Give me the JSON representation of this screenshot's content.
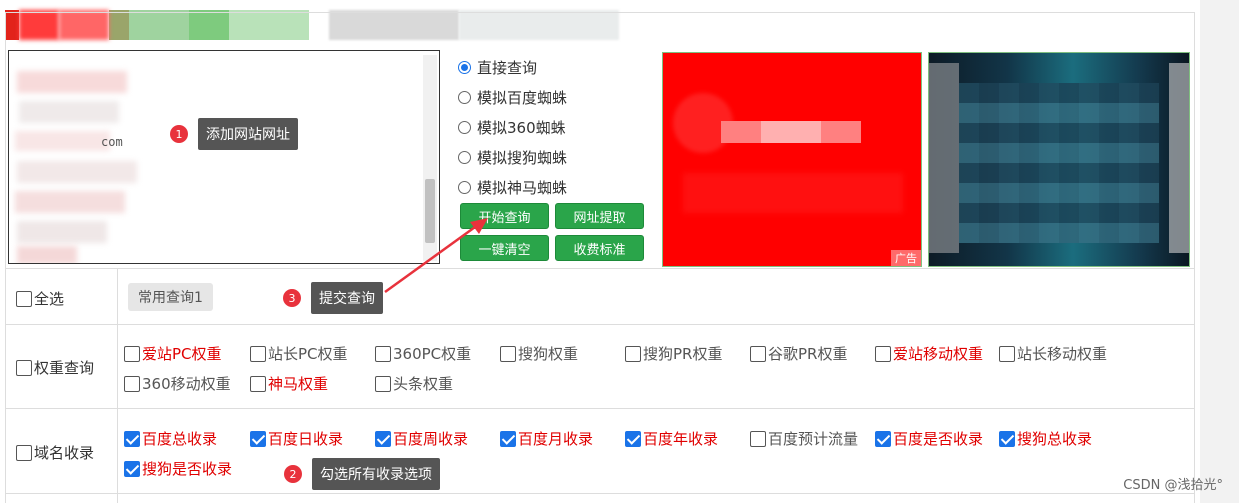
{
  "query_modes": [
    {
      "label": "直接查询",
      "selected": true
    },
    {
      "label": "模拟百度蜘蛛",
      "selected": false
    },
    {
      "label": "模拟360蜘蛛",
      "selected": false
    },
    {
      "label": "模拟搜狗蜘蛛",
      "selected": false
    },
    {
      "label": "模拟神马蜘蛛",
      "selected": false
    }
  ],
  "buttons": {
    "start": "开始查询",
    "extract": "网址提取",
    "clear": "一键清空",
    "pricing": "收费标准"
  },
  "url_box": {
    "visible_fragments": [
      "com"
    ]
  },
  "ad": {
    "tag": "广告"
  },
  "select_all": "全选",
  "preset_query": "常用查询1",
  "weight_row": {
    "label": "权重查询",
    "items": [
      {
        "label": "爱站PC权重",
        "checked": false,
        "color": "red"
      },
      {
        "label": "站长PC权重",
        "checked": false,
        "color": "gray"
      },
      {
        "label": "360PC权重",
        "checked": false,
        "color": "gray"
      },
      {
        "label": "搜狗权重",
        "checked": false,
        "color": "gray"
      },
      {
        "label": "搜狗PR权重",
        "checked": false,
        "color": "gray"
      },
      {
        "label": "谷歌PR权重",
        "checked": false,
        "color": "gray"
      },
      {
        "label": "爱站移动权重",
        "checked": false,
        "color": "red"
      },
      {
        "label": "站长移动权重",
        "checked": false,
        "color": "gray"
      },
      {
        "label": "360移动权重",
        "checked": false,
        "color": "gray"
      },
      {
        "label": "神马权重",
        "checked": false,
        "color": "red"
      },
      {
        "label": "头条权重",
        "checked": false,
        "color": "gray"
      }
    ]
  },
  "index_row": {
    "label": "域名收录",
    "items": [
      {
        "label": "百度总收录",
        "checked": true,
        "color": "red"
      },
      {
        "label": "百度日收录",
        "checked": true,
        "color": "red"
      },
      {
        "label": "百度周收录",
        "checked": true,
        "color": "red"
      },
      {
        "label": "百度月收录",
        "checked": true,
        "color": "red"
      },
      {
        "label": "百度年收录",
        "checked": true,
        "color": "red"
      },
      {
        "label": "百度预计流量",
        "checked": false,
        "color": "gray"
      },
      {
        "label": "百度是否收录",
        "checked": true,
        "color": "red"
      },
      {
        "label": "搜狗总收录",
        "checked": true,
        "color": "red"
      },
      {
        "label": "搜狗是否收录",
        "checked": true,
        "color": "red"
      }
    ]
  },
  "annotations": [
    {
      "num": "1",
      "text": "添加网站网址"
    },
    {
      "num": "2",
      "text": "勾选所有收录选项"
    },
    {
      "num": "3",
      "text": "提交查询"
    }
  ],
  "watermark": "CSDN @浅拾光°",
  "colors": {
    "accent_blue": "#1a73e8",
    "button_green": "#2aa54a",
    "label_red": "#e00000",
    "annotation_red": "#e8323c",
    "tooltip_gray": "#555555"
  }
}
